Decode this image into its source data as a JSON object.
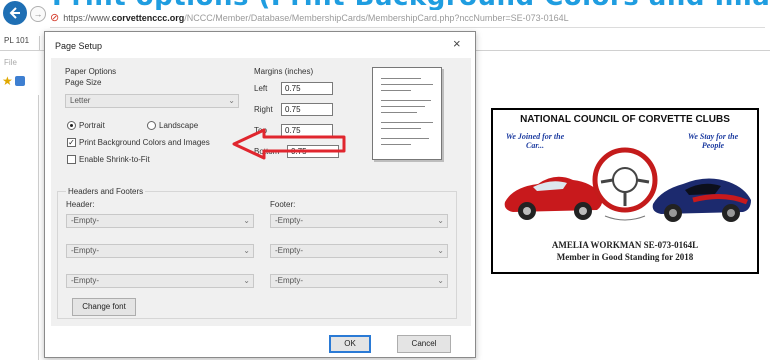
{
  "banner": {
    "text": "Print options (Print Background Colors and Images)"
  },
  "browser": {
    "address_scheme": "https://www.",
    "address_domain": "corvettenccc.org",
    "address_path": "/NCCC/Member/Database/MembershipCards/MembershipCard.php?nccNumber=SE-073-0164L",
    "tab_label": "PL 101",
    "side_file": "File"
  },
  "dialog": {
    "title": "Page Setup",
    "close_glyph": "×",
    "paper_options_label": "Paper Options",
    "page_size_label": "Page Size",
    "page_size_value": "Letter",
    "orientation": {
      "portrait_label": "Portrait",
      "landscape_label": "Landscape",
      "selected": "portrait"
    },
    "print_bg_label": "Print Background Colors and Images",
    "print_bg_checked": true,
    "shrink_label": "Enable Shrink-to-Fit",
    "shrink_checked": false,
    "margins_label": "Margins (inches)",
    "margins": [
      {
        "label": "Left",
        "value": "0.75"
      },
      {
        "label": "Right",
        "value": "0.75"
      },
      {
        "label": "Top",
        "value": "0.75"
      },
      {
        "label": "Bottom",
        "value": "0.75"
      }
    ],
    "headers_footers_label": "Headers and Footers",
    "header_label": "Header:",
    "footer_label": "Footer:",
    "header_values": [
      "-Empty-",
      "-Empty-",
      "-Empty-"
    ],
    "footer_values": [
      "-Empty-",
      "-Empty-",
      "-Empty-"
    ],
    "change_font_label": "Change font",
    "ok_label": "OK",
    "cancel_label": "Cancel"
  },
  "card": {
    "title": "NATIONAL COUNCIL OF CORVETTE CLUBS",
    "tag_left": "We Joined for the Car...",
    "tag_right": "We Stay for the People",
    "member_name": "AMELIA WORKMAN   SE-073-0164L",
    "member_status": "Member in Good Standing for 2018"
  },
  "colors": {
    "accent": "#1f9de0",
    "annotation_arrow": "#e0262e",
    "card_border": "#000000",
    "card_text_blue": "#1d3ca0"
  }
}
